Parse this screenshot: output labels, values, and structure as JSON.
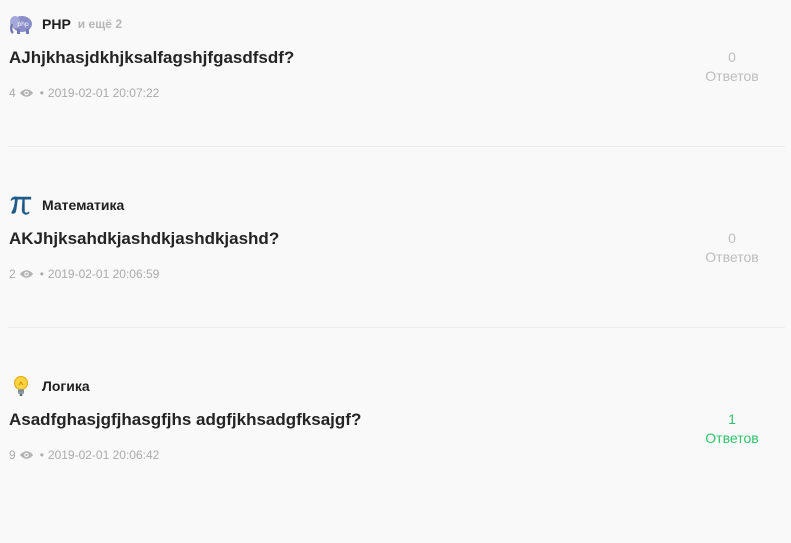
{
  "questions": [
    {
      "tag": "PHP",
      "tag_icon": "php-elephant-icon",
      "tag_more": "и ещё 2",
      "title": "AJhjkhasjdkhjksalfagshjfgasdfsdf?",
      "views": "4",
      "date": "2019-02-01 20:07:22",
      "answers_count": "0",
      "answers_label": "Ответов"
    },
    {
      "tag": "Математика",
      "tag_icon": "pi-icon",
      "tag_more": "",
      "title": "AKJhjksahdkjashdkjashdkjashd?",
      "views": "2",
      "date": "2019-02-01 20:06:59",
      "answers_count": "0",
      "answers_label": "Ответов"
    },
    {
      "tag": "Логика",
      "tag_icon": "lightbulb-icon",
      "tag_more": "",
      "title": "Asadfghasjgfjhasgfjhs adgfjkhsadgfksajgf?",
      "views": "9",
      "date": "2019-02-01 20:06:42",
      "answers_count": "1",
      "answers_label": "Ответов"
    }
  ],
  "colors": {
    "answered": "#2ec56a",
    "unanswered": "#bdbdbd",
    "meta": "#aaaaaa",
    "pi": "#1f5a8a"
  },
  "meta_separator": "•"
}
